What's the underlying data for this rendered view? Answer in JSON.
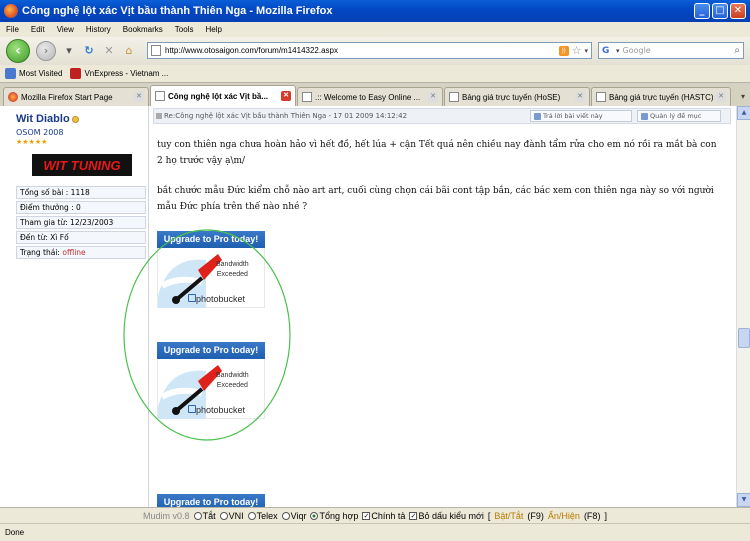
{
  "window": {
    "title": "Công nghệ lột xác Vịt bầu thành Thiên Nga - Mozilla Firefox",
    "buttons": [
      "_",
      "□",
      "✕"
    ]
  },
  "menu": [
    "File",
    "Edit",
    "View",
    "History",
    "Bookmarks",
    "Tools",
    "Help"
  ],
  "nav": {
    "url": "http://www.otosaigon.com/forum/m1414322.aspx",
    "search_placeholder": "Google"
  },
  "bookmarks": [
    "Most Visited",
    "VnExpress - Vietnam ..."
  ],
  "tabs": [
    {
      "label": "Mozilla Firefox Start Page",
      "active": false
    },
    {
      "label": "Công nghệ lột xác Vịt bầ...",
      "active": true
    },
    {
      "label": ".:: Welcome to Easy Online ...",
      "active": false
    },
    {
      "label": "Bảng giá trực tuyến (HoSE)",
      "active": false
    },
    {
      "label": "Bảng giá trực tuyến (HASTC)",
      "active": false
    }
  ],
  "profile": {
    "username": "Wit Diablo",
    "rank": "OSOM 2008",
    "stars": "★★★★★",
    "banner": "WIT TUNING",
    "stats": [
      {
        "label": "Tổng số bài : 1118"
      },
      {
        "label": "Điểm thưởng : 0"
      },
      {
        "label": "Tham gia từ: 12/23/2003"
      },
      {
        "label": "Đến từ: Xì Fố"
      }
    ],
    "status_label": "Trạng thái:",
    "status_value": "offline"
  },
  "post": {
    "header": "Re:Công nghệ lột xác Vịt bầu thành Thiên Nga - 17 01 2009 14:12:42",
    "reply_button": "Trả lời bài viết này",
    "manage_button": "Quản lý đề mục",
    "paragraph1": "tuy con thiên nga chưa hoàn hảo vì hết đồ, hết lúa + cận Tết quá nên chiều nay đành tẩm rửa cho em nó rồi ra mắt bà con 2 họ trước vậy ạ\\m/",
    "paragraph2": "bắt chước mẫu Đức kiểm chỗ nào art art, cuối cùng chọn cái bãi cont tập bắn, các bác xem con thiên nga này so với người mẫu Đức phía trên thế nào nhé ?"
  },
  "photobucket": {
    "header": "Upgrade to Pro today!",
    "line1": "Bandwidth",
    "line2": "Exceeded",
    "brand": "photobucket"
  },
  "mudim": {
    "brand": "Mudim v0.8",
    "options": [
      "Tắt",
      "VNI",
      "Telex",
      "Viqr",
      "Tổng hợp"
    ],
    "selected": "Tổng hợp",
    "chinh_ta": "Chính tả",
    "bo_dau": "Bỏ dấu kiểu mới",
    "toggle_open": "[",
    "toggle_link": "Bật/Tắt",
    "toggle_key": "(F9)",
    "show_link": "Ẩn/Hiện",
    "show_key": "(F8)",
    "toggle_close": "]"
  },
  "status": "Done",
  "colors": {
    "titlebar": "#0348c4",
    "username": "#1a3a8a",
    "offline": "#c03030",
    "photobucket": "#1f5fb0",
    "annotation_circle": "#4cc04c"
  }
}
